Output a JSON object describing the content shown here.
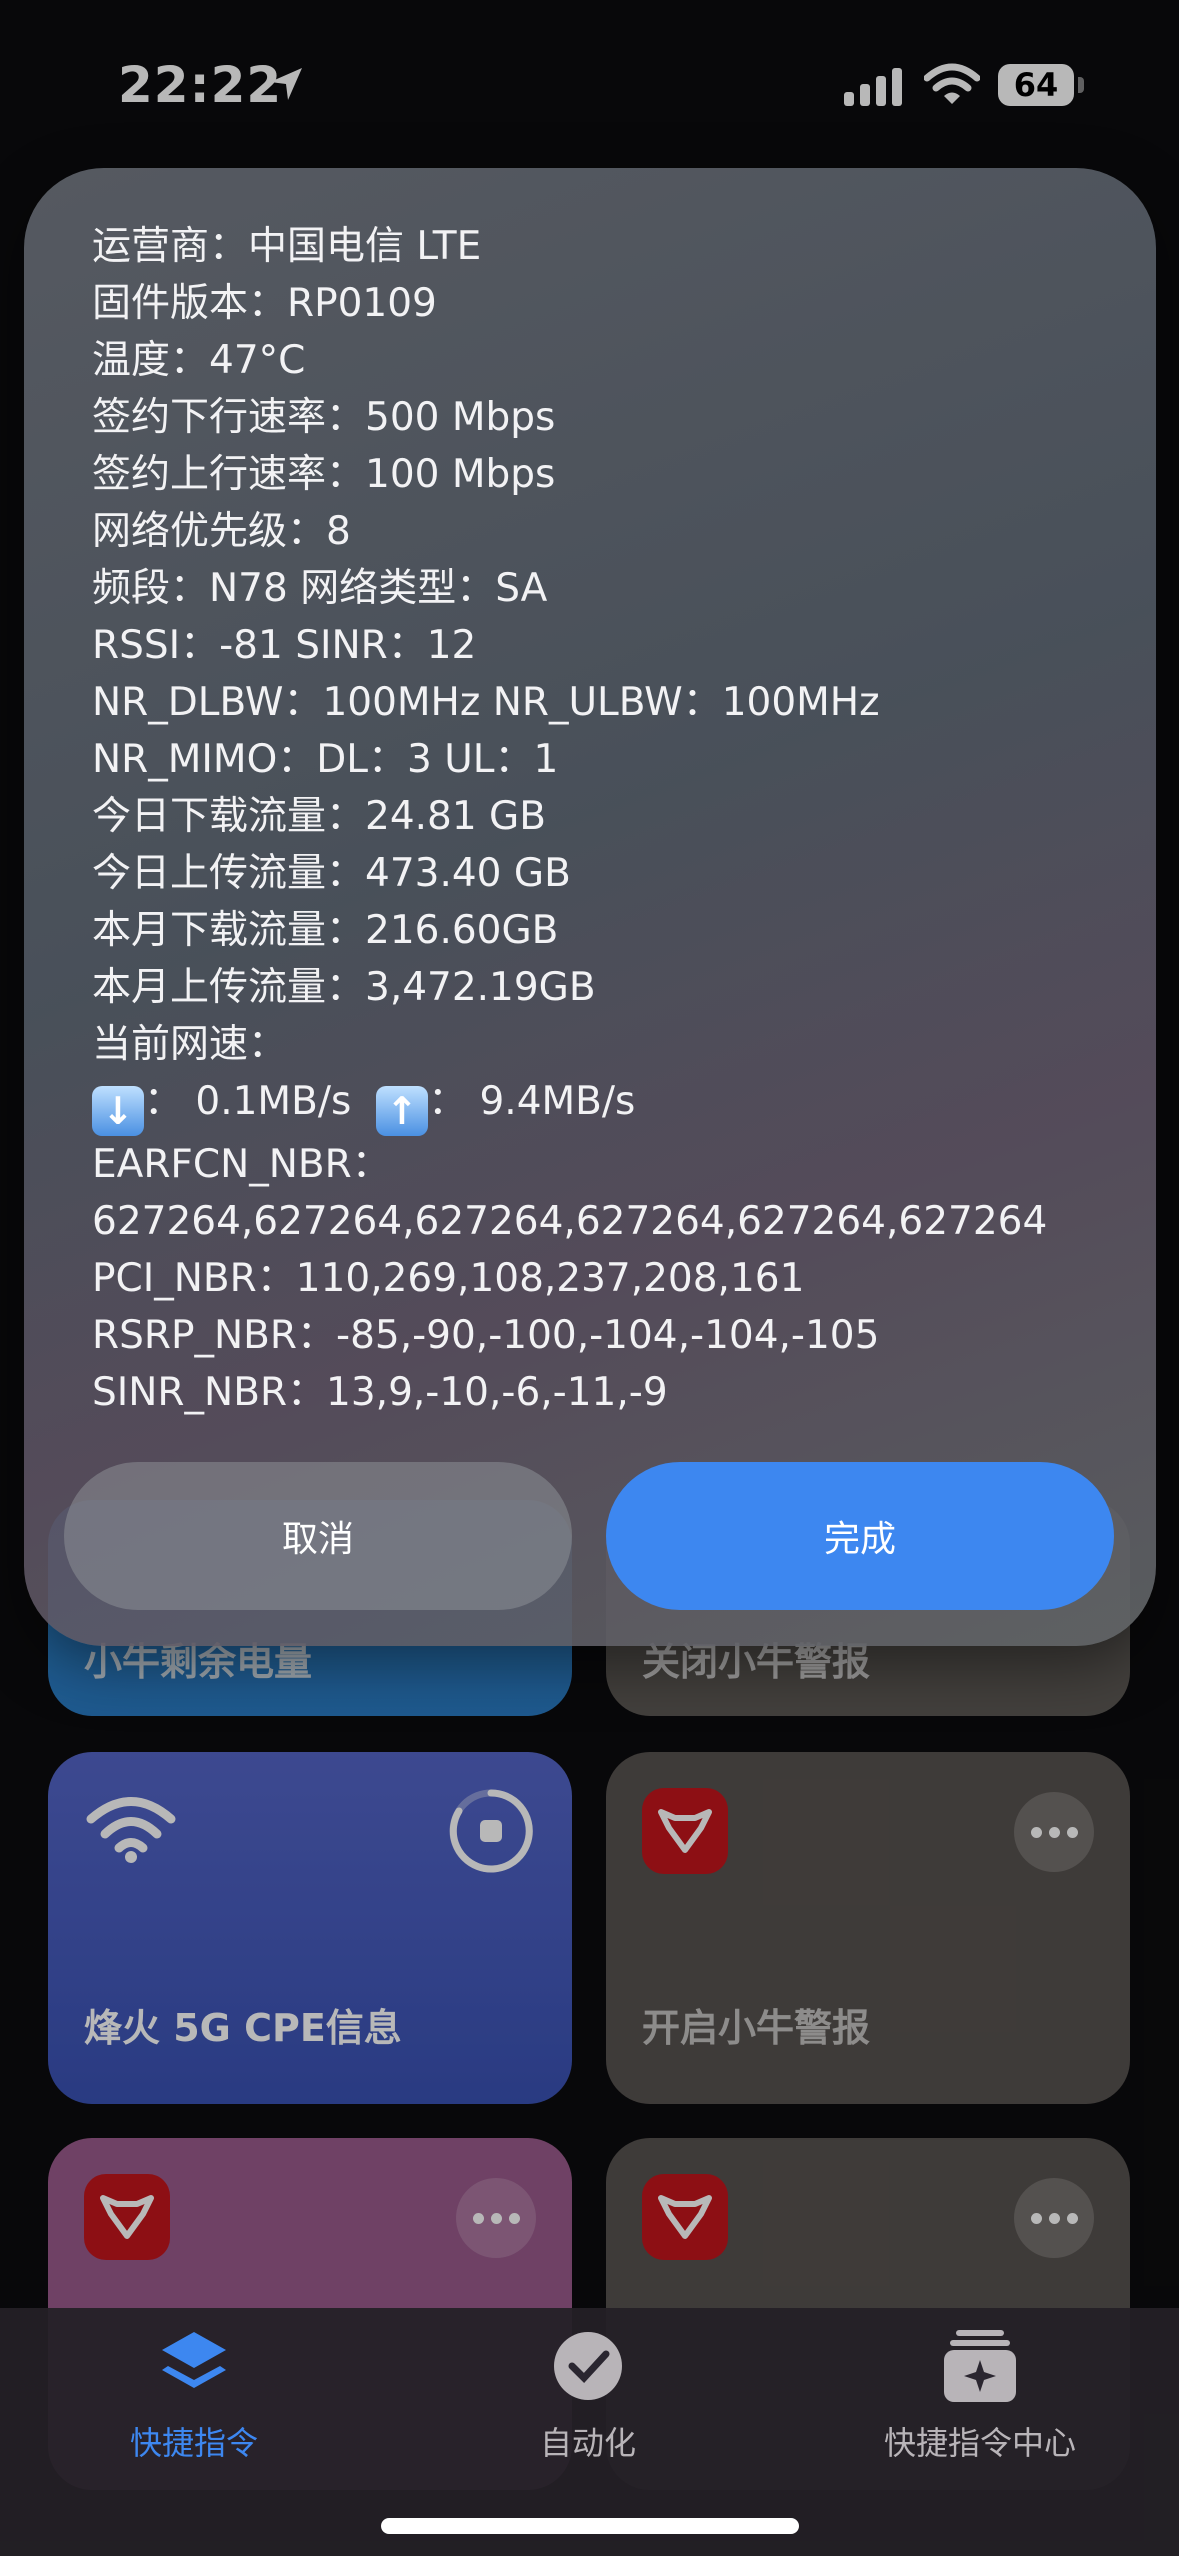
{
  "status_bar": {
    "time": "22:22",
    "battery": "64"
  },
  "tiles": [
    {
      "title": "小牛剩余电量"
    },
    {
      "title": "关闭小牛警报"
    },
    {
      "title": "烽火 5G CPE信息"
    },
    {
      "title": "开启小牛警报"
    },
    {
      "title": ""
    },
    {
      "title": ""
    }
  ],
  "dialog": {
    "lines": [
      "运营商：中国电信 LTE",
      "固件版本：RP0109",
      "温度：47°C",
      "签约下行速率：500 Mbps",
      "签约上行速率：100 Mbps",
      "网络优先级：8",
      "频段：N78  网络类型：SA",
      "RSSI：-81   SINR：12",
      "NR_DLBW：100MHz  NR_ULBW：100MHz",
      "NR_MIMO：DL：3  UL：1",
      "今日下载流量：24.81 GB",
      "今日上传流量：473.40 GB",
      "本月下载流量：216.60GB",
      "本月上传流量：3,472.19GB",
      "当前网速："
    ],
    "speed": {
      "down": "：  0.1MB/s",
      "up": "：  9.4MB/s"
    },
    "lines_after": [
      "EARFCN_NBR：",
      "627264,627264,627264,627264,627264,627264",
      "PCI_NBR：110,269,108,237,208,161",
      "RSRP_NBR：-85,-90,-100,-104,-104,-105",
      "SINR_NBR：13,9,-10,-6,-11,-9"
    ],
    "cancel_label": "取消",
    "done_label": "完成"
  },
  "tabbar": {
    "items": [
      {
        "label": "快捷指令",
        "icon": "layers-icon",
        "active": true
      },
      {
        "label": "自动化",
        "icon": "clock-check-icon",
        "active": false
      },
      {
        "label": "快捷指令中心",
        "icon": "gallery-icon",
        "active": false
      }
    ]
  },
  "colors": {
    "accent": "#3d87f0",
    "tile_blue": "#3d55b8",
    "tile_pink": "#9a5a8c",
    "tile_gray": "#57524f",
    "app_red": "#c4161c"
  }
}
